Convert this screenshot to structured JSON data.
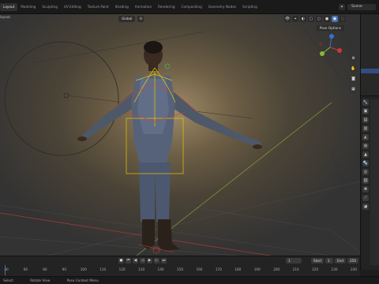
{
  "workspace_tabs": [
    "Layout",
    "Modeling",
    "Sculpting",
    "UV Editing",
    "Texture Paint",
    "Shading",
    "Animation",
    "Rendering",
    "Compositing",
    "Geometry Nodes",
    "Scripting"
  ],
  "active_tab_index": 0,
  "scene_name": "Scene",
  "viewport": {
    "header_mode": "Global",
    "pose_options": "Pose Options",
    "left_label": "layout"
  },
  "timeline": {
    "current_frame": "1",
    "start_label": "Start",
    "start": "1",
    "end_label": "End",
    "end": "250",
    "ruler": [
      "40",
      "60",
      "80",
      "90",
      "100",
      "110",
      "120",
      "130",
      "140",
      "150",
      "160",
      "170",
      "180",
      "190",
      "200",
      "210",
      "220",
      "230",
      "240"
    ]
  },
  "status": {
    "item1": "Select",
    "item2": "Rotate View",
    "item3": "Pose Context Menu"
  },
  "colors": {
    "accent": "#4772b3",
    "bone_outline": "#e8c600",
    "axis_x": "#c83a3a",
    "axis_y": "#a4c83a"
  }
}
